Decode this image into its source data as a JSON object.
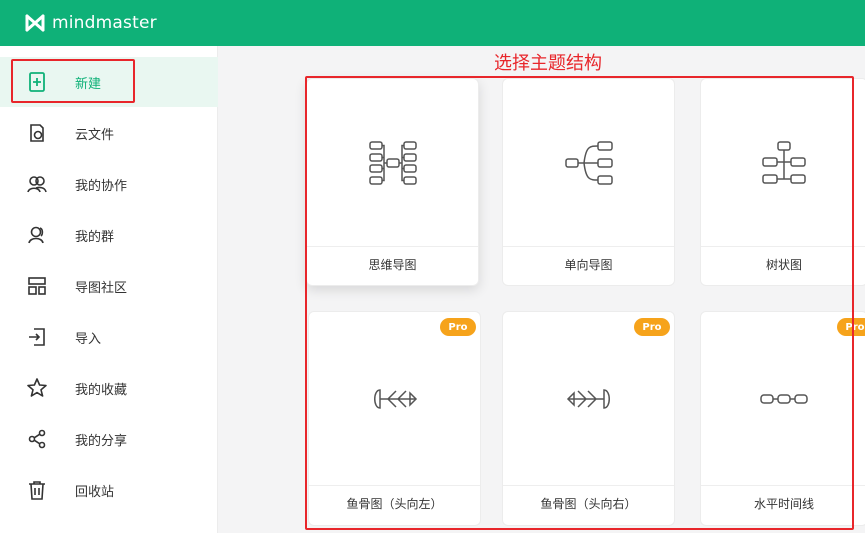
{
  "app": {
    "name": "mindmaster"
  },
  "annotation": "选择主题结构",
  "sidebar": {
    "items": [
      {
        "label": "新建",
        "icon": "new-file-icon",
        "active": true
      },
      {
        "label": "云文件",
        "icon": "cloud-file-icon"
      },
      {
        "label": "我的协作",
        "icon": "collaboration-icon"
      },
      {
        "label": "我的群",
        "icon": "group-icon"
      },
      {
        "label": "导图社区",
        "icon": "community-icon"
      },
      {
        "label": "导入",
        "icon": "import-icon"
      },
      {
        "label": "我的收藏",
        "icon": "star-icon"
      },
      {
        "label": "我的分享",
        "icon": "share-icon"
      },
      {
        "label": "回收站",
        "icon": "trash-icon"
      }
    ]
  },
  "templates": [
    {
      "label": "思维导图",
      "icon": "mind-map-icon",
      "pro": false
    },
    {
      "label": "单向导图",
      "icon": "one-way-map-icon",
      "pro": false
    },
    {
      "label": "树状图",
      "icon": "tree-chart-icon",
      "pro": false
    },
    {
      "label": "鱼骨图（头向左）",
      "icon": "fishbone-left-icon",
      "pro": true,
      "badge": "Pro"
    },
    {
      "label": "鱼骨图（头向右）",
      "icon": "fishbone-right-icon",
      "pro": true,
      "badge": "Pro"
    },
    {
      "label": "水平时间线",
      "icon": "timeline-icon",
      "pro": true,
      "badge": "Pro"
    }
  ],
  "colors": {
    "brand": "#0fb178",
    "annotation": "#e8262b",
    "pro_badge": "#f6a31b"
  }
}
